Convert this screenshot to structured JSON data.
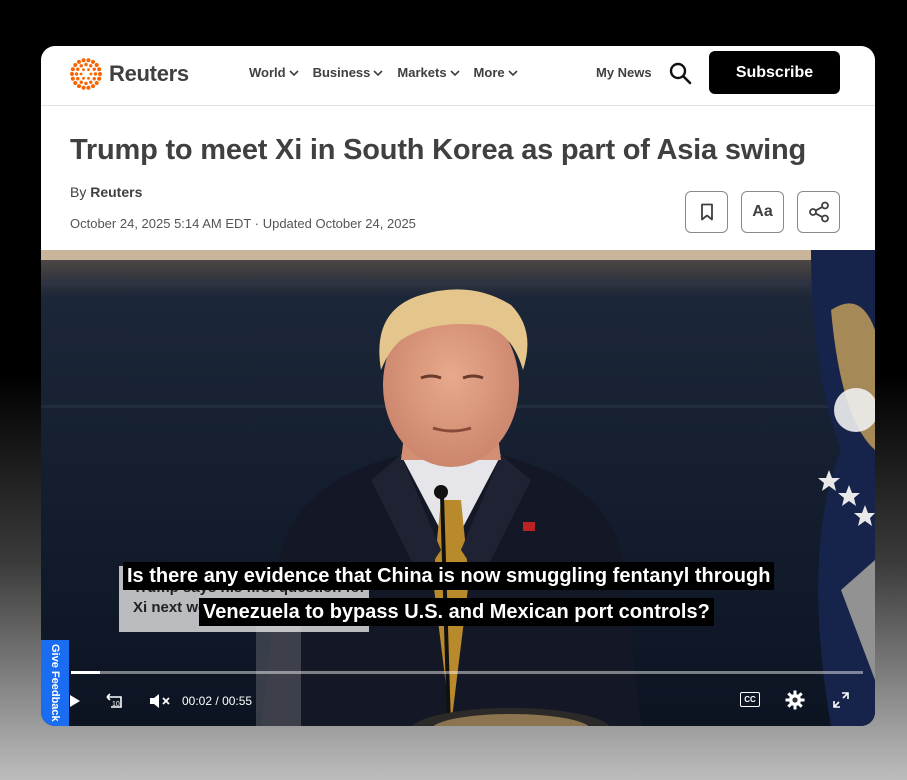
{
  "header": {
    "logo_text": "Reuters",
    "nav": [
      {
        "label": "World"
      },
      {
        "label": "Business"
      },
      {
        "label": "Markets"
      },
      {
        "label": "More"
      }
    ],
    "my_news": "My News",
    "subscribe": "Subscribe"
  },
  "article": {
    "headline": "Trump to meet Xi in South Korea as part of Asia swing",
    "byline_prefix": "By",
    "byline_author": "Reuters",
    "dateline": "October 24, 2025 5:14 AM EDT · Updated October 24, 2025",
    "text_size_label": "Aa"
  },
  "video": {
    "overlay_title": "Trump says his first question for Xi next we",
    "caption_line1": "Is there any evidence that China is now smuggling fentanyl through",
    "caption_line2": "Venezuela to bypass U.S. and Mexican port controls?",
    "current_time": "00:02",
    "separator": "/",
    "duration": "00:55",
    "progress": 0.036,
    "cc_label": "CC",
    "skip_label": "10"
  },
  "feedback": {
    "label": "Give Feedback"
  },
  "colors": {
    "brand_orange": "#fa6400",
    "text_dark": "#404040",
    "feedback_blue": "#1a6cf0"
  }
}
